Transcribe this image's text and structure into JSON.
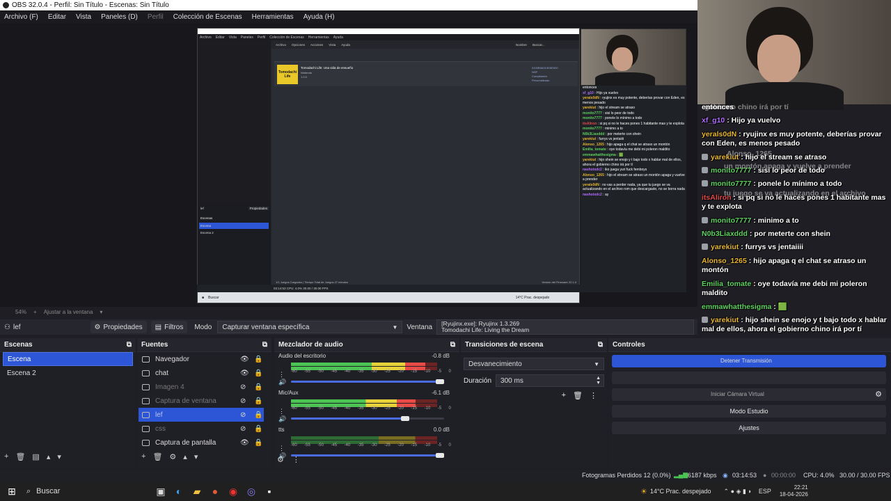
{
  "title": "OBS 32.0.4 - Perfil: Sin Título - Escenas: Sin Título",
  "menu": [
    "Archivo (F)",
    "Editar",
    "Vista",
    "Paneles (D)",
    "Perfil",
    "Colección de Escenas",
    "Herramientas",
    "Ayuda (H)"
  ],
  "zoom": {
    "percent": "54%",
    "fit": "Ajustar a la ventana"
  },
  "source_toolbar": {
    "source_name": "lef",
    "properties": "Propiedades",
    "filters": "Filtros",
    "mode_label": "Modo",
    "mode_value": "Capturar ventana específica",
    "window_label": "Ventana",
    "window_value_1": "[Ryujinx.exe]: Ryujinx 1.3.269",
    "window_value_2": "Tomodachi Life: Living the Dream"
  },
  "scenes": {
    "title": "Escenas",
    "items": [
      "Escena",
      "Escena 2"
    ],
    "selected": 0
  },
  "sources": {
    "title": "Fuentes",
    "items": [
      {
        "label": "Navegador",
        "icon": "browser-icon",
        "visible": true
      },
      {
        "label": "chat",
        "icon": "browser-icon",
        "visible": true
      },
      {
        "label": "Imagen 4",
        "icon": "image-icon",
        "visible": false
      },
      {
        "label": "Captura de ventana",
        "icon": "window-capture-icon",
        "visible": false
      },
      {
        "label": "lef",
        "icon": "gamepad-icon",
        "visible": false
      },
      {
        "label": "css",
        "icon": "browser-icon",
        "visible": false
      },
      {
        "label": "Captura de pantalla",
        "icon": "monitor-icon",
        "visible": true
      }
    ],
    "selected": 4
  },
  "mixer": {
    "title": "Mezclador de audio",
    "channels": [
      {
        "name": "Audio del escritorio",
        "db": "-0.8 dB",
        "level": 0.92,
        "volume": 1.0
      },
      {
        "name": "Mic/Aux",
        "db": "-6.1 dB",
        "level": 0.85,
        "volume": 0.76
      },
      {
        "name": "tts",
        "db": "0.0 dB",
        "level": 0.0,
        "volume": 1.0
      }
    ],
    "scale": [
      "-60",
      "-55",
      "-50",
      "-45",
      "-40",
      "-35",
      "-30",
      "-25",
      "-20",
      "-15",
      "-10",
      "-5",
      "0"
    ]
  },
  "transitions": {
    "title": "Transiciones de escena",
    "type": "Desvanecimiento",
    "duration_label": "Duración",
    "duration_value": "300 ms"
  },
  "controls": {
    "title": "Controles",
    "stop_stream": "Detener Transmisión",
    "virtual_cam": "Iniciar Cámara Virtual",
    "studio_mode": "Modo Estudio",
    "settings": "Ajustes"
  },
  "status": {
    "dropped": "Fotogramas Perdidos 12 (0.0%)",
    "bitrate": "6187 kbps",
    "live_time": "03:14:53",
    "rec_time": "00:00:00",
    "cpu": "CPU: 4.0%",
    "fps": "30.00 / 30.00 FPS"
  },
  "taskbar": {
    "search": "Buscar",
    "weather": "14°C  Prac. despejado",
    "time": "22:21",
    "date": "18-04-2026",
    "lang": "ESP"
  },
  "chat": [
    {
      "user": "",
      "text": "entonces",
      "color": "#ffffff",
      "badge": false
    },
    {
      "user": "xf_g10",
      "text": "Hijo ya vuelvo",
      "color": "#b26cff",
      "badge": false
    },
    {
      "user": "yerals0dN",
      "text": "ryujinx es muy potente, deberías provar con Eden, es menos pesado",
      "color": "#e7b52f",
      "badge": false
    },
    {
      "user": "yarekiut",
      "text": "hijo el stream se atraso",
      "color": "#e7b52f",
      "badge": true
    },
    {
      "user": "monito7777",
      "text": "sisi lo peor de todo",
      "color": "#5fd35f",
      "badge": true
    },
    {
      "user": "monito7777",
      "text": "ponele lo mínimo a todo",
      "color": "#5fd35f",
      "badge": true
    },
    {
      "user": "itsAliron",
      "text": "si pq si no le haces pones 1 habitante mas y te explota",
      "color": "#e34a4a",
      "badge": false
    },
    {
      "user": "monito7777",
      "text": "minimo a to",
      "color": "#5fd35f",
      "badge": true
    },
    {
      "user": "N0b3Liaxddd",
      "text": "por meterte con shein",
      "color": "#5fd35f",
      "badge": false
    },
    {
      "user": "yarekiut",
      "text": "furrys vs jentaiiii",
      "color": "#e7b52f",
      "badge": true
    },
    {
      "user": "Alonso_1265",
      "text": "hijo apaga q el chat se atraso un montón",
      "color": "#e7b52f",
      "badge": false
    },
    {
      "user": "Emilia_tomate",
      "text": "oye todavía me debi mi poleron maldito",
      "color": "#5fd35f",
      "badge": false
    },
    {
      "user": "emmawhatthesigma",
      "text": "🟩",
      "color": "#5fd35f",
      "badge": false
    },
    {
      "user": "yarekiut",
      "text": "hijo shein se enojo y t bajo todo x hablar mal de ellos, ahora el gobierno chino irá por tí",
      "color": "#e7b52f",
      "badge": true
    },
    {
      "user": "nashotxdc2",
      "text": "iko juega yuri fuck femboys",
      "color": "#b26cff",
      "badge": false
    },
    {
      "user": "Alonso_1265",
      "text": "hijo el stream se atraso un montón apaga y vuelve a prender",
      "color": "#e7b52f",
      "badge": false
    },
    {
      "user": "yerals0dN",
      "text": "no vas a perder nada, ya que tu juego se va actualizando en el archivo rom que descargaste, no se borra nada",
      "color": "#e7b52f",
      "badge": false
    },
    {
      "user": "nashotxdc2",
      "text": "ay",
      "color": "#b26cff",
      "badge": false
    }
  ],
  "chat_ghost": [
    "gobierno chino irá por tí",
    "Alonso_1265",
    "un montón apaga y vuelve a prender",
    "tu juego se va actualizando en el archivo"
  ],
  "preview": {
    "menu": [
      "Archivo",
      "Editar",
      "Vista",
      "Paneles",
      "Perfil",
      "Colección de Escenas",
      "Herramientas",
      "Ayuda"
    ],
    "app_tabs": [
      "Archivo",
      "Opciones",
      "Acciones",
      "Vista",
      "Ayuda"
    ],
    "sort_label": "Nombre",
    "search_label": "Buscar...",
    "game_title": "Tomodachi Life: Una vida de ensueño",
    "game_publisher": "Nintendo",
    "game_version": "1.0.0",
    "game_thumb": "Tomodachi Life",
    "game_id": "0100B5A019D5E000",
    "game_fmt": "NSP",
    "game_size": "Compilación",
    "game_misc": "Personalizado",
    "status_left": "1/1 Juegos Cargados | Tiempo Total de Juegos 27 minutos",
    "status_right": "Versión del Firmware 22.1.0",
    "scenes_title": "Escenas",
    "scenes": [
      "Escena",
      "Escena 2"
    ],
    "source_label": "lef",
    "props_label": "Propiedades",
    "taskbar_search": "Buscar",
    "taskbar_weather": "14°C  Prac. despejado",
    "bottom_stats": "03:14:53   CPU: 4.0%   30.00 / 30.00 FPS"
  }
}
